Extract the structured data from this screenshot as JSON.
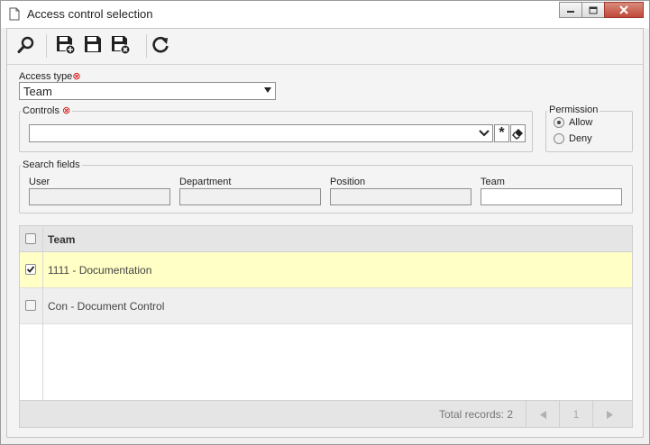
{
  "window": {
    "title": "Access control selection",
    "icons": [
      "document-icon",
      "minimize-icon",
      "maximize-icon",
      "close-icon"
    ]
  },
  "toolbar": {
    "buttons": [
      {
        "name": "search-button",
        "icon": "magnifier-icon"
      },
      {
        "name": "save-new-button",
        "icon": "save-plus-icon"
      },
      {
        "name": "save-button",
        "icon": "save-icon"
      },
      {
        "name": "save-close-button",
        "icon": "save-close-icon"
      },
      {
        "name": "refresh-button",
        "icon": "refresh-icon"
      }
    ]
  },
  "form": {
    "access_type_label": "Access type",
    "access_type_value": "Team",
    "controls_label": "Controls",
    "controls_value": "",
    "controls_star": "*",
    "permission_label": "Permission",
    "permission_options": [
      "Allow",
      "Deny"
    ],
    "permission_selected": "Allow"
  },
  "search_fields": {
    "legend": "Search fields",
    "user_label": "User",
    "department_label": "Department",
    "position_label": "Position",
    "team_label": "Team",
    "user_value": "",
    "department_value": "",
    "position_value": "",
    "team_value": ""
  },
  "grid": {
    "header": "Team",
    "rows": [
      {
        "label": "1111 - Documentation",
        "checked": true
      },
      {
        "label": "Con - Document Control",
        "checked": false
      }
    ],
    "total_label": "Total records: 2",
    "page": "1"
  },
  "colors": {
    "selected_row": "#ffffc6",
    "required": "#d20000",
    "close_button": "#c0493a"
  }
}
